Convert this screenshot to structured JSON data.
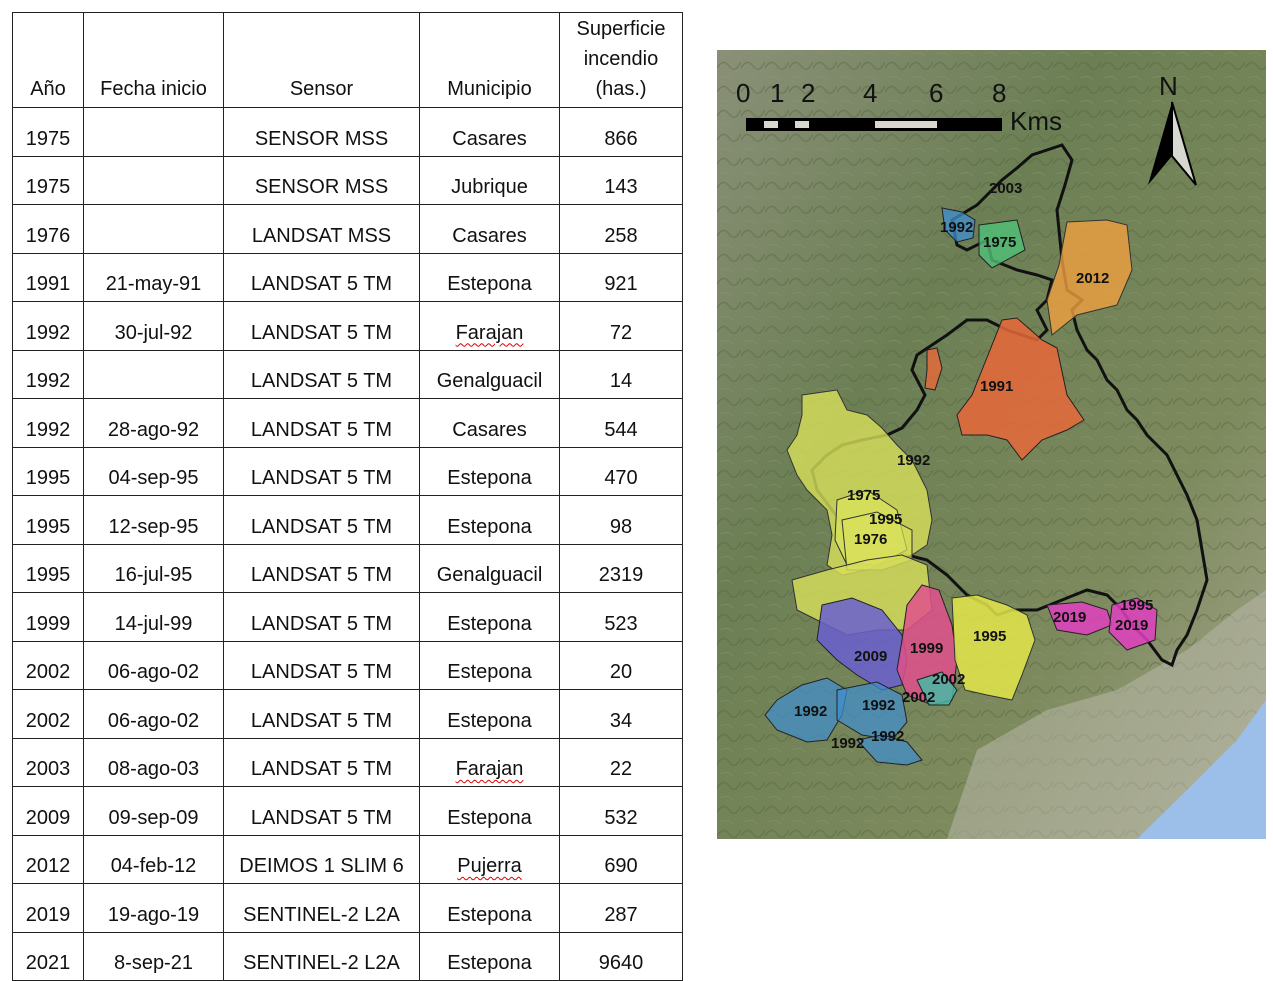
{
  "table": {
    "headers": {
      "year": "Año",
      "start_date": "Fecha inicio",
      "sensor": "Sensor",
      "municipality": "Municipio",
      "area_line1": "Superficie",
      "area_line2": "incendio",
      "area_line3": "(has.)"
    },
    "rows": [
      {
        "year": "1975",
        "date": "",
        "sensor": "SENSOR MSS",
        "municipality": "Casares",
        "area": "866"
      },
      {
        "year": "1975",
        "date": "",
        "sensor": "SENSOR MSS",
        "municipality": "Jubrique",
        "area": "143"
      },
      {
        "year": "1976",
        "date": "",
        "sensor": "LANDSAT MSS",
        "municipality": "Casares",
        "area": "258"
      },
      {
        "year": "1991",
        "date": "21-may-91",
        "sensor": "LANDSAT 5 TM",
        "municipality": "Estepona",
        "area": "921"
      },
      {
        "year": "1992",
        "date": "30-jul-92",
        "sensor": "LANDSAT 5 TM",
        "municipality": "Farajan",
        "area": "72"
      },
      {
        "year": "1992",
        "date": "",
        "sensor": "LANDSAT 5 TM",
        "municipality": "Genalguacil",
        "area": "14"
      },
      {
        "year": "1992",
        "date": "28-ago-92",
        "sensor": "LANDSAT 5 TM",
        "municipality": "Casares",
        "area": "544"
      },
      {
        "year": "1995",
        "date": "04-sep-95",
        "sensor": "LANDSAT 5 TM",
        "municipality": "Estepona",
        "area": "470"
      },
      {
        "year": "1995",
        "date": "12-sep-95",
        "sensor": "LANDSAT 5 TM",
        "municipality": "Estepona",
        "area": "98"
      },
      {
        "year": "1995",
        "date": "16-jul-95",
        "sensor": "LANDSAT 5 TM",
        "municipality": "Genalguacil",
        "area": "2319"
      },
      {
        "year": "1999",
        "date": "14-jul-99",
        "sensor": "LANDSAT 5 TM",
        "municipality": "Estepona",
        "area": "523"
      },
      {
        "year": "2002",
        "date": "06-ago-02",
        "sensor": "LANDSAT 5 TM",
        "municipality": "Estepona",
        "area": "20"
      },
      {
        "year": "2002",
        "date": "06-ago-02",
        "sensor": "LANDSAT 5 TM",
        "municipality": "Estepona",
        "area": "34"
      },
      {
        "year": "2003",
        "date": "08-ago-03",
        "sensor": "LANDSAT 5 TM",
        "municipality": "Farajan",
        "area": "22"
      },
      {
        "year": "2009",
        "date": "09-sep-09",
        "sensor": "LANDSAT 5 TM",
        "municipality": "Estepona",
        "area": "532"
      },
      {
        "year": "2012",
        "date": "04-feb-12",
        "sensor": "DEIMOS 1 SLIM 6",
        "municipality": "Pujerra",
        "area": "690"
      },
      {
        "year": "2019",
        "date": "19-ago-19",
        "sensor": "SENTINEL-2 L2A",
        "municipality": "Estepona",
        "area": "287"
      },
      {
        "year": "2021",
        "date": "8-sep-21",
        "sensor": "SENTINEL-2 L2A",
        "municipality": "Estepona",
        "area": "9640"
      }
    ],
    "spellcheck_flagged": [
      "Farajan",
      "Pujerra"
    ]
  },
  "map": {
    "scale_bar": {
      "ticks": [
        "0",
        "1",
        "2",
        "4",
        "6",
        "8"
      ],
      "unit": "Kms"
    },
    "north_arrow": "N",
    "fire_labels": [
      "2003",
      "1992",
      "1975",
      "2012",
      "1991",
      "1992",
      "1975",
      "1995",
      "1976",
      "2019",
      "1995",
      "2019",
      "1995",
      "2009",
      "1999",
      "2002",
      "2002",
      "1992",
      "1992",
      "1992",
      "1992"
    ],
    "colors": {
      "1975": "#7fd88f",
      "1976": "#d8e05a",
      "1991": "#e8693a",
      "1992": "#3f8fd0",
      "1995": "#e3e64a",
      "1999": "#e0508c",
      "2002": "#3fbfa8",
      "2003": "#5aa0c8",
      "2009": "#6a5fd0",
      "2012": "#f0a040",
      "2019": "#e040c0",
      "terrain": "#6f8255",
      "sea": "#9bbfe8"
    }
  }
}
